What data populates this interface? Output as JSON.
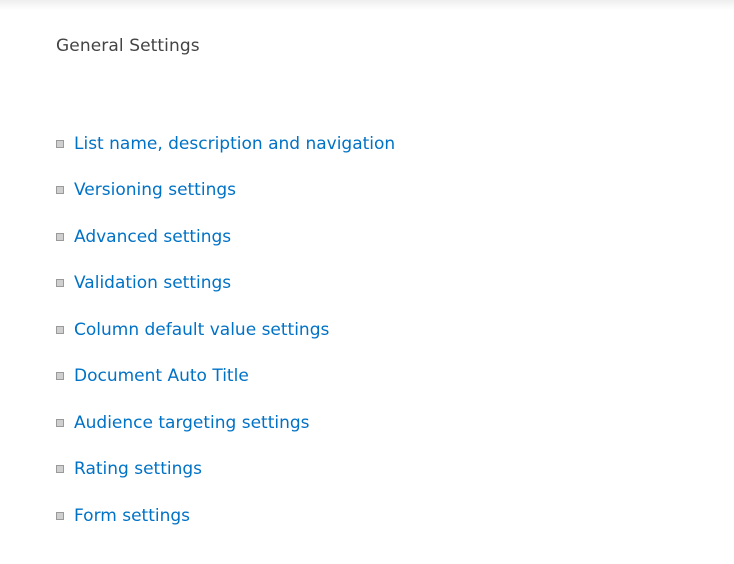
{
  "section": {
    "title": "General Settings"
  },
  "settings_links": [
    {
      "label": "List name, description and navigation"
    },
    {
      "label": "Versioning settings"
    },
    {
      "label": "Advanced settings"
    },
    {
      "label": "Validation settings"
    },
    {
      "label": "Column default value settings"
    },
    {
      "label": "Document Auto Title"
    },
    {
      "label": "Audience targeting settings"
    },
    {
      "label": "Rating settings"
    },
    {
      "label": "Form settings"
    }
  ],
  "colors": {
    "link": "#0072c6",
    "title": "#444444",
    "bullet_fill": "#cfcfcf",
    "bullet_border": "#9a9a9a"
  },
  "icons": {
    "bullet": "square-bullet-icon"
  }
}
